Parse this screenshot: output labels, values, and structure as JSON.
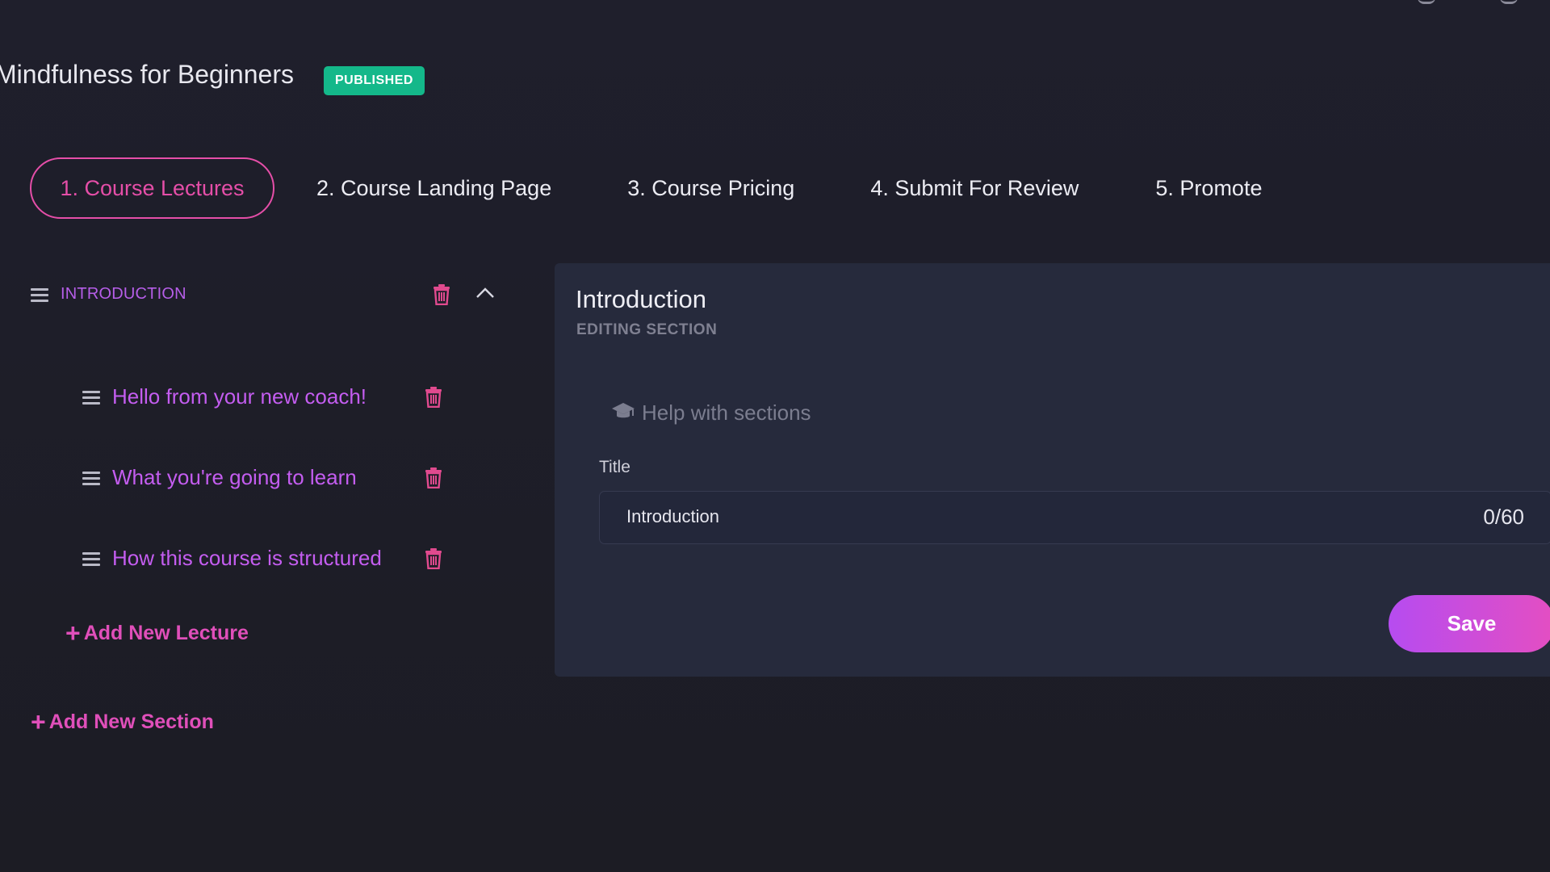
{
  "course": {
    "title": "Mindfulness for Beginners",
    "status": "PUBLISHED"
  },
  "tabs": [
    {
      "label": "1. Course Lectures",
      "active": true
    },
    {
      "label": "2. Course Landing Page",
      "active": false
    },
    {
      "label": "3. Course Pricing",
      "active": false
    },
    {
      "label": "4. Submit For Review",
      "active": false
    },
    {
      "label": "5. Promote",
      "active": false
    }
  ],
  "curriculum": {
    "section_name": "INTRODUCTION",
    "lectures": [
      {
        "title": "Hello from your new coach!"
      },
      {
        "title": "What you're going to learn"
      },
      {
        "title": "How this course is structured"
      }
    ],
    "add_lecture_label": "Add New Lecture",
    "add_section_label": "Add New Section"
  },
  "editor": {
    "heading": "Introduction",
    "subheading": "EDITING SECTION",
    "help_label": "Help with sections",
    "title_label": "Title",
    "title_value": "Introduction",
    "char_counter": "0/60",
    "save_label": "Save"
  },
  "colors": {
    "accent_pink": "#e54ea8",
    "accent_purple": "#c45df0",
    "badge_green": "#14b88a",
    "panel_bg": "#262a3c",
    "page_bg": "#1c1c24"
  },
  "icons": {
    "drag_handle": "hamburger-icon",
    "delete": "trash-icon",
    "collapse": "chevron-up-icon",
    "help": "graduation-cap-icon",
    "add": "plus-icon"
  }
}
